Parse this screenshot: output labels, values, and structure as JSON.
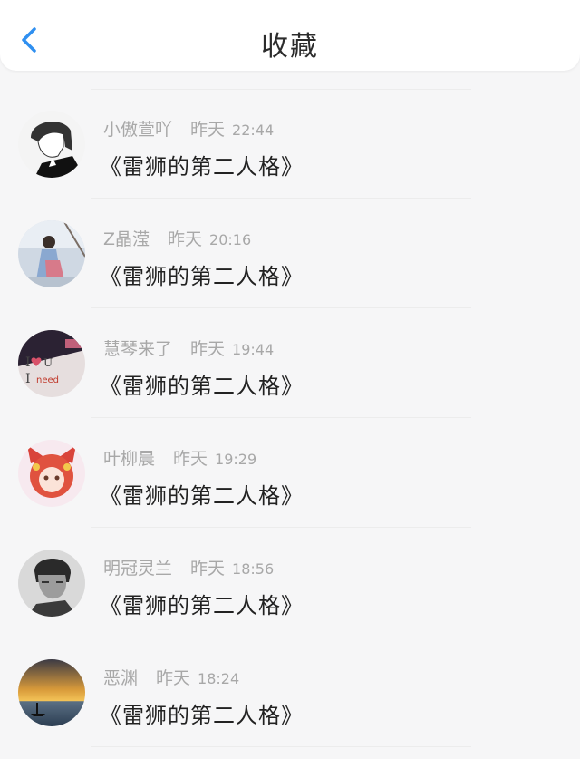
{
  "header": {
    "title": "收藏"
  },
  "items": [
    {
      "name": "小傲萱吖",
      "day": "昨天",
      "time": "22:44",
      "message": "《雷狮的第二人格》"
    },
    {
      "name": "Z晶滢",
      "day": "昨天",
      "time": "20:16",
      "message": "《雷狮的第二人格》"
    },
    {
      "name": "慧琴来了",
      "day": "昨天",
      "time": "19:44",
      "message": "《雷狮的第二人格》"
    },
    {
      "name": "叶柳晨",
      "day": "昨天",
      "time": "19:29",
      "message": "《雷狮的第二人格》"
    },
    {
      "name": "明冠灵兰",
      "day": "昨天",
      "time": "18:56",
      "message": "《雷狮的第二人格》"
    },
    {
      "name": "恶渊",
      "day": "昨天",
      "time": "18:24",
      "message": "《雷狮的第二人格》"
    }
  ],
  "colors": {
    "accent": "#2f8ff0",
    "meta_text": "#a8a8a8",
    "message_text": "#222222"
  }
}
